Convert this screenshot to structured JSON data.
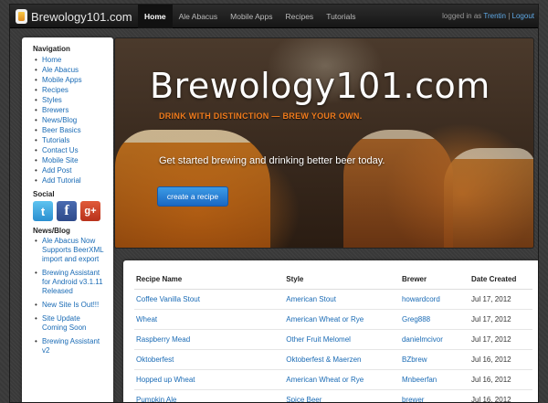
{
  "navbar": {
    "brand": "Brewology101.com",
    "links": [
      "Home",
      "Ale Abacus",
      "Mobile Apps",
      "Recipes",
      "Tutorials"
    ],
    "logged_in_text": "logged in as",
    "username": "Trentin",
    "separator": "|",
    "logout": "Logout"
  },
  "sidebar": {
    "nav_heading": "Navigation",
    "nav_items": [
      "Home",
      "Ale Abacus",
      "Mobile Apps",
      "Recipes",
      "Styles",
      "Brewers",
      "News/Blog",
      "Beer Basics",
      "Tutorials",
      "Contact Us",
      "Mobile Site",
      "Add Post",
      "Add Tutorial"
    ],
    "social_heading": "Social",
    "social": [
      {
        "icon": "twitter-icon",
        "glyph": "t"
      },
      {
        "icon": "facebook-icon",
        "glyph": "f"
      },
      {
        "icon": "google-plus-icon",
        "glyph": "g+"
      }
    ],
    "news_heading": "News/Blog",
    "news_items": [
      "Ale Abacus Now Supports BeerXML import and export",
      "Brewing Assistant for Android v3.1.11 Released",
      "New Site Is Out!!!",
      "Site Update Coming Soon",
      "Brewing Assistant v2"
    ]
  },
  "hero": {
    "title": "Brewology101.com",
    "tagline": "DRINK WITH DISTINCTION — BREW YOUR OWN.",
    "subtitle": "Get started brewing and drinking better beer today.",
    "button": "create a recipe"
  },
  "recipes": {
    "headers": [
      "Recipe Name",
      "Style",
      "Brewer",
      "Date Created"
    ],
    "rows": [
      [
        "Coffee Vanilla Stout",
        "American Stout",
        "howardcord",
        "Jul 17, 2012"
      ],
      [
        "Wheat",
        "American Wheat or Rye",
        "Greg888",
        "Jul 17, 2012"
      ],
      [
        "Raspberry Mead",
        "Other Fruit Melomel",
        "danielmcivor",
        "Jul 17, 2012"
      ],
      [
        "Oktoberfest",
        "Oktoberfest & Maerzen",
        "BZbrew",
        "Jul 16, 2012"
      ],
      [
        "Hopped up Wheat",
        "American Wheat or Rye",
        "Mnbeerfan",
        "Jul 16, 2012"
      ],
      [
        "Pumpkin Ale",
        "Spice Beer",
        "brewer",
        "Jul 16, 2012"
      ]
    ]
  }
}
